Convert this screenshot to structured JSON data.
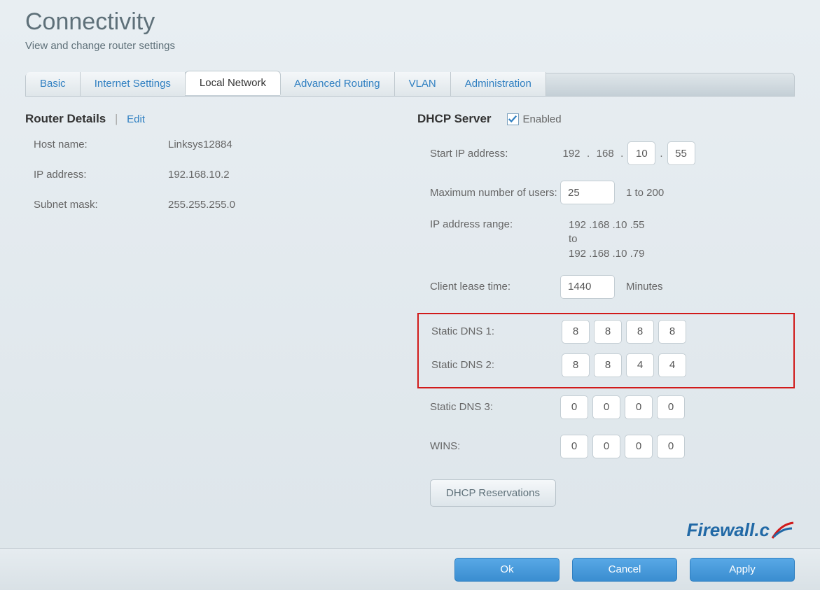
{
  "header": {
    "title": "Connectivity",
    "subtitle": "View and change router settings"
  },
  "tabs": {
    "basic": "Basic",
    "internet": "Internet Settings",
    "local": "Local Network",
    "routing": "Advanced Routing",
    "vlan": "VLAN",
    "admin": "Administration"
  },
  "router_details": {
    "heading": "Router Details",
    "edit": "Edit",
    "host_label": "Host name:",
    "host_value": "Linksys12884",
    "ip_label": "IP address:",
    "ip_value": "192.168.10.2",
    "mask_label": "Subnet mask:",
    "mask_value": "255.255.255.0"
  },
  "dhcp": {
    "heading": "DHCP Server",
    "enabled_label": "Enabled",
    "start_label": "Start IP address:",
    "start_oct1": "192",
    "start_oct2": "168",
    "start_oct3": "10",
    "start_oct4": "55",
    "max_label": "Maximum number of users:",
    "max_value": "25",
    "max_hint": "1 to 200",
    "range_label": "IP address range:",
    "range_line1": "192 .168 .10 .55",
    "range_to": "to",
    "range_line2": "192 .168 .10 .79",
    "lease_label": "Client lease time:",
    "lease_value": "1440",
    "lease_unit": "Minutes",
    "dns1_label": "Static DNS 1:",
    "dns1": {
      "a": "8",
      "b": "8",
      "c": "8",
      "d": "8"
    },
    "dns2_label": "Static DNS 2:",
    "dns2": {
      "a": "8",
      "b": "8",
      "c": "4",
      "d": "4"
    },
    "dns3_label": "Static DNS 3:",
    "dns3": {
      "a": "0",
      "b": "0",
      "c": "0",
      "d": "0"
    },
    "wins_label": "WINS:",
    "wins": {
      "a": "0",
      "b": "0",
      "c": "0",
      "d": "0"
    },
    "reservations_btn": "DHCP Reservations"
  },
  "brand": "Firewall.c",
  "footer": {
    "ok": "Ok",
    "cancel": "Cancel",
    "apply": "Apply"
  }
}
